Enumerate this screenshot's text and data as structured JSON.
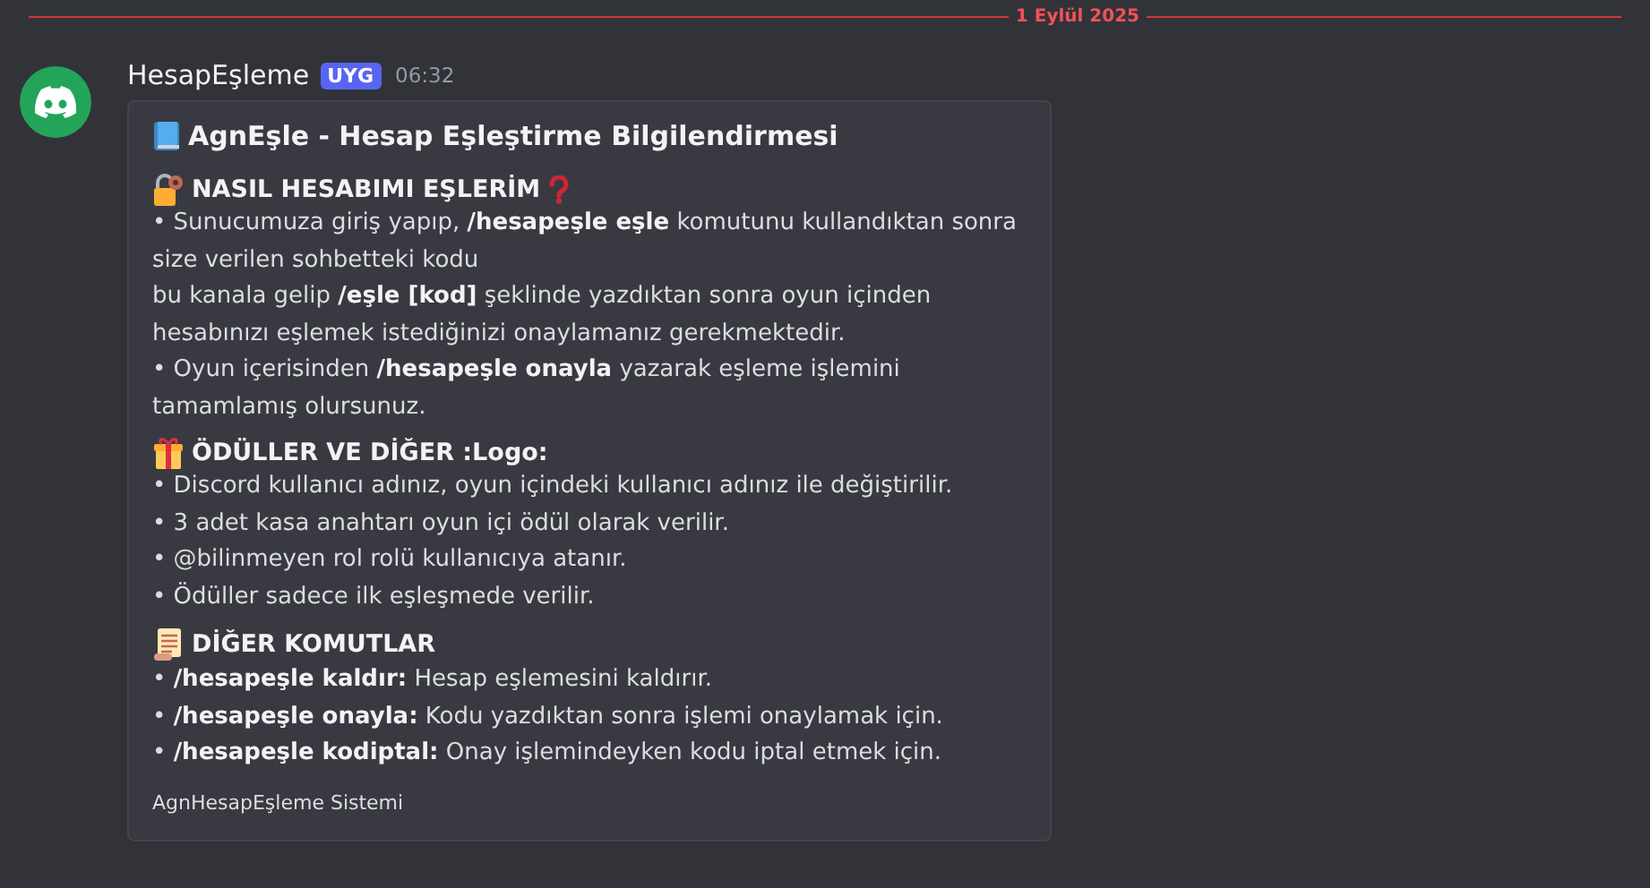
{
  "date_divider": "1 Eylül 2025",
  "message": {
    "author": "HesapEşleme",
    "tag": "UYG",
    "time": "06:32",
    "embed": {
      "title": "AgnEşle - Hesap Eşleştirme Bilgilendirmesi",
      "sections": [
        {
          "kind": "lock",
          "heading": "NASIL HESABIMI EŞLERİM",
          "lines": [
            "• Sunucumuza giriş yapıp, **/hesapeşle eşle** komutunu kullandıktan sonra size verilen sohbetteki kodu",
            "bu kanala gelip **/eşle [kod]** şeklinde yazdıktan sonra oyun içinden hesabınızı eşlemek istediğinizi onaylamanız gerekmektedir.",
            "• Oyun içerisinden **/hesapeşle onayla** yazarak eşleme işlemini tamamlamış olursunuz."
          ]
        },
        {
          "kind": "gift",
          "heading": "ÖDÜLLER VE DİĞER :Logo:",
          "lines": [
            "• Discord kullanıcı adınız, oyun içindeki kullanıcı adınız ile değiştirilir.",
            "• 3 adet kasa anahtarı oyun içi ödül olarak verilir.",
            "• @bilinmeyen rol rolü kullanıcıya atanır.",
            "• Ödüller sadece ilk eşleşmede verilir."
          ]
        },
        {
          "kind": "scroll",
          "heading": "DİĞER KOMUTLAR",
          "lines": [
            "• **/hesapeşle kaldır:** Hesap eşlemesini kaldırır.",
            "• **/hesapeşle onayla:** Kodu yazdıktan sonra işlemi onaylamak için.",
            "• **/hesapeşle kodiptal:** Onay işlemindeyken kodu iptal etmek için."
          ]
        }
      ],
      "footer": "AgnHesapEşleme Sistemi"
    }
  }
}
